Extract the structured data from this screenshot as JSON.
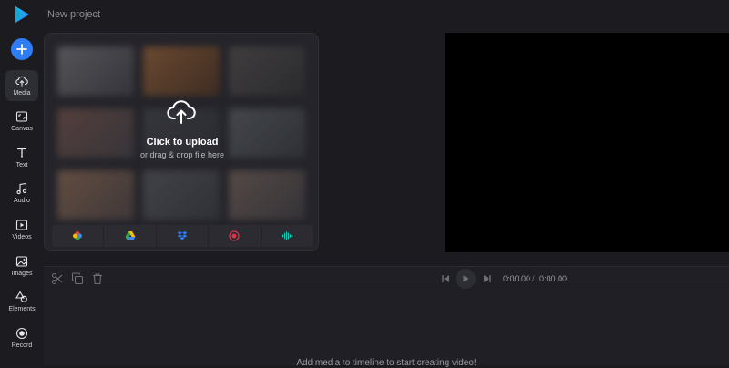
{
  "app": {
    "project_name": "New project"
  },
  "sidebar": {
    "items": [
      {
        "label": "Media",
        "icon": "cloud-upload-icon",
        "active": true
      },
      {
        "label": "Canvas",
        "icon": "canvas-icon"
      },
      {
        "label": "Text",
        "icon": "text-icon"
      },
      {
        "label": "Audio",
        "icon": "music-note-icon"
      },
      {
        "label": "Videos",
        "icon": "video-icon"
      },
      {
        "label": "Images",
        "icon": "image-icon"
      },
      {
        "label": "Elements",
        "icon": "shapes-icon"
      },
      {
        "label": "Record",
        "icon": "record-icon"
      }
    ]
  },
  "media_panel": {
    "upload_title": "Click to upload",
    "upload_subtitle": "or drag & drop file here",
    "sources": [
      {
        "icon": "google-photos-icon"
      },
      {
        "icon": "google-drive-icon"
      },
      {
        "icon": "dropbox-icon"
      },
      {
        "icon": "record-screen-icon"
      },
      {
        "icon": "audio-wave-icon"
      }
    ]
  },
  "timeline": {
    "current_time": "0:00.00",
    "separator": "/",
    "total_time": "0:00.00",
    "empty_hint": "Add media to timeline to start creating video!"
  },
  "colors": {
    "accent": "#2f7df6",
    "background": "#1b1b20",
    "panel": "#24242a",
    "preview": "#000000"
  }
}
